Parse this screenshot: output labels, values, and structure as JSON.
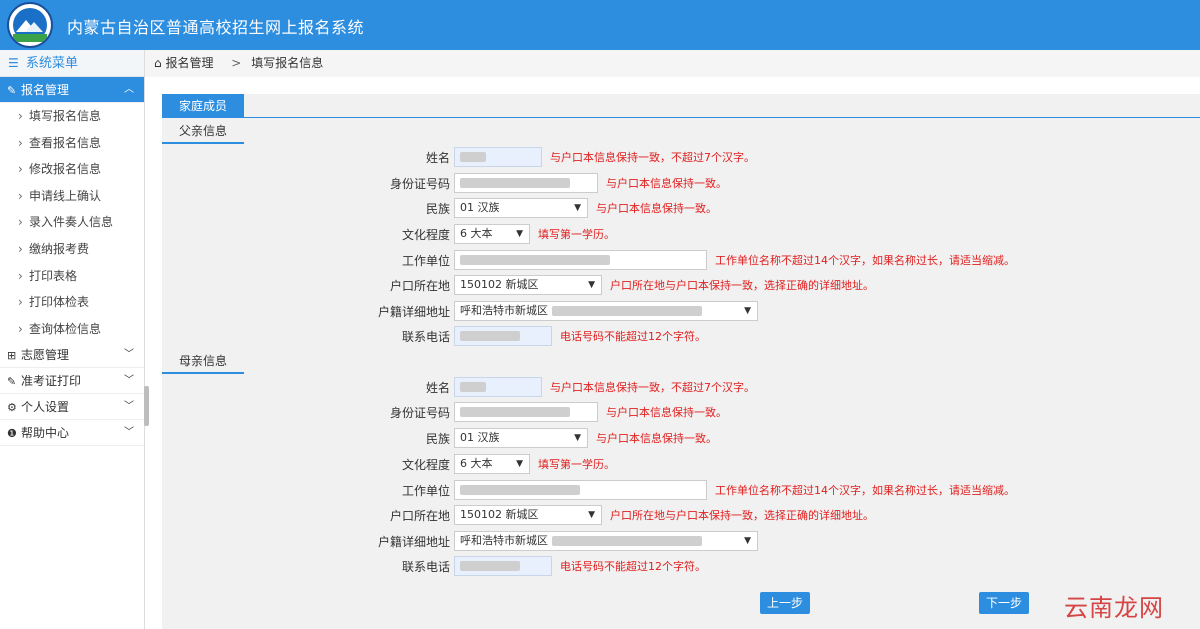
{
  "header": {
    "title": "内蒙古自治区普通高校招生网上报名系统"
  },
  "sidebar": {
    "heading": "系统菜单",
    "groups": [
      {
        "label": "报名管理",
        "expanded": true,
        "items": [
          "填写报名信息",
          "查看报名信息",
          "修改报名信息",
          "申请线上确认",
          "录入件奏人信息",
          "缴纳报考费",
          "打印表格",
          "打印体检表",
          "查询体检信息"
        ]
      },
      {
        "label": "志愿管理"
      },
      {
        "label": "准考证打印"
      },
      {
        "label": "个人设置"
      },
      {
        "label": "帮助中心"
      }
    ]
  },
  "breadcrumb": {
    "home": "报名管理",
    "current": "填写报名信息"
  },
  "tab": {
    "label": "家庭成员"
  },
  "father": {
    "section": "父亲信息",
    "labels": {
      "name": "姓名",
      "id": "身份证号码",
      "nation": "民族",
      "edu": "文化程度",
      "work": "工作单位",
      "hukou": "户口所在地",
      "addr": "户籍详细地址",
      "phone": "联系电话"
    },
    "values": {
      "nation": "01 汉族",
      "edu": "6 大本",
      "hukou": "150102 新城区",
      "addr": "呼和浩特市新城区"
    },
    "hints": {
      "name": "与户口本信息保持一致，不超过7个汉字。",
      "id": "与户口本信息保持一致。",
      "nation": "与户口本信息保持一致。",
      "edu": "填写第一学历。",
      "work": "工作单位名称不超过14个汉字，如果名称过长，请适当缩减。",
      "hukou": "户口所在地与户口本保持一致，选择正确的详细地址。",
      "phone": "电话号码不能超过12个字符。"
    }
  },
  "mother": {
    "section": "母亲信息",
    "labels": {
      "name": "姓名",
      "id": "身份证号码",
      "nation": "民族",
      "edu": "文化程度",
      "work": "工作单位",
      "hukou": "户口所在地",
      "addr": "户籍详细地址",
      "phone": "联系电话"
    },
    "values": {
      "nation": "01 汉族",
      "edu": "6 大本",
      "hukou": "150102 新城区",
      "addr": "呼和浩特市新城区"
    },
    "hints": {
      "name": "与户口本信息保持一致，不超过7个汉字。",
      "id": "与户口本信息保持一致。",
      "nation": "与户口本信息保持一致。",
      "edu": "填写第一学历。",
      "work": "工作单位名称不超过14个汉字，如果名称过长，请适当缩减。",
      "hukou": "户口所在地与户口本保持一致，选择正确的详细地址。",
      "phone": "电话号码不能超过12个字符。"
    }
  },
  "buttons": {
    "prev": "上一步",
    "next": "下一步"
  },
  "watermark": "云南龙网",
  "colors": {
    "primary": "#2d8ee0",
    "hint": "#e02020"
  }
}
